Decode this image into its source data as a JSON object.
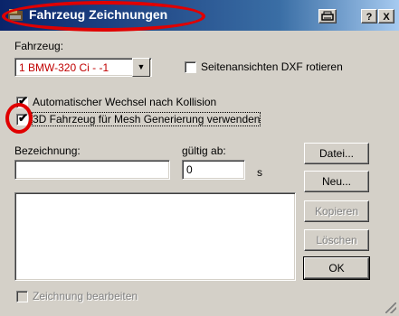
{
  "window": {
    "title": "Fahrzeug Zeichnungen",
    "print_button": "🖶",
    "help_button": "?",
    "close_button": "X"
  },
  "vehicle": {
    "label": "Fahrzeug:",
    "selected": "1  BMW-320 Ci - -1"
  },
  "options": {
    "rotate_dxf_label": "Seitenansichten DXF rotieren",
    "rotate_dxf_checked": false,
    "auto_switch_label": "Automatischer Wechsel nach Kollision",
    "auto_switch_checked": true,
    "mesh_label": "3D Fahrzeug für Mesh Generierung verwenden",
    "mesh_checked": true
  },
  "form": {
    "name_label": "Bezeichnung:",
    "name_value": "",
    "valid_label": "gültig ab:",
    "valid_value": "0",
    "valid_unit": "s"
  },
  "buttons": {
    "file": "Datei...",
    "new": "Neu...",
    "copy": "Kopieren",
    "delete": "Löschen",
    "ok": "OK"
  },
  "edit_drawing": {
    "label": "Zeichnung bearbeiten",
    "checked": false
  },
  "colors": {
    "accent_annotation": "#e00000",
    "titlebar": "#0a246a"
  }
}
